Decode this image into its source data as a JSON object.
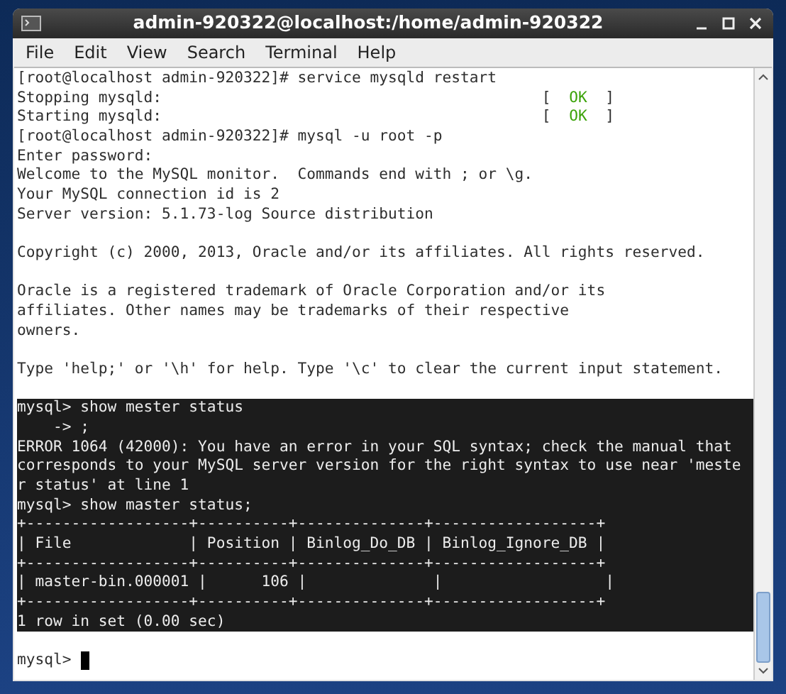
{
  "window": {
    "title": "admin-920322@localhost:/home/admin-920322"
  },
  "menu": [
    "File",
    "Edit",
    "View",
    "Search",
    "Terminal",
    "Help"
  ],
  "lines": [
    {
      "text": "[root@localhost admin-920322]# service mysqld restart",
      "selected": false
    },
    {
      "text": "Stopping mysqld:",
      "selected": false,
      "status": {
        "open": "[",
        "label": "OK",
        "close": "]"
      }
    },
    {
      "text": "Starting mysqld:",
      "selected": false,
      "status": {
        "open": "[",
        "label": "OK",
        "close": "]"
      }
    },
    {
      "text": "[root@localhost admin-920322]# mysql -u root -p",
      "selected": false
    },
    {
      "text": "Enter password:",
      "selected": false
    },
    {
      "text": "Welcome to the MySQL monitor.  Commands end with ; or \\g.",
      "selected": false
    },
    {
      "text": "Your MySQL connection id is 2",
      "selected": false
    },
    {
      "text": "Server version: 5.1.73-log Source distribution",
      "selected": false
    },
    {
      "selected": false
    },
    {
      "text": "Copyright (c) 2000, 2013, Oracle and/or its affiliates. All rights reserved.",
      "selected": false
    },
    {
      "selected": false
    },
    {
      "text": "Oracle is a registered trademark of Oracle Corporation and/or its",
      "selected": false
    },
    {
      "text": "affiliates. Other names may be trademarks of their respective",
      "selected": false
    },
    {
      "text": "owners.",
      "selected": false
    },
    {
      "selected": false
    },
    {
      "text": "Type 'help;' or '\\h' for help. Type '\\c' to clear the current input statement.",
      "selected": false
    },
    {
      "selected": false
    },
    {
      "text": "mysql> show mester status",
      "selected": true
    },
    {
      "text": "    -> ;",
      "selected": true
    },
    {
      "text": "ERROR 1064 (42000): You have an error in your SQL syntax; check the manual that",
      "selected": true
    },
    {
      "text": "corresponds to your MySQL server version for the right syntax to use near 'meste",
      "selected": true
    },
    {
      "text": "r status' at line 1",
      "selected": true
    },
    {
      "text": "mysql> show master status;",
      "selected": true
    },
    {
      "text": "+------------------+----------+--------------+------------------+",
      "selected": true
    },
    {
      "text": "| File             | Position | Binlog_Do_DB | Binlog_Ignore_DB |",
      "selected": true
    },
    {
      "text": "+------------------+----------+--------------+------------------+",
      "selected": true
    },
    {
      "text": "| master-bin.000001 |      106 |              |                  |",
      "selected": true
    },
    {
      "text": "+------------------+----------+--------------+------------------+",
      "selected": true
    },
    {
      "text": "1 row in set (0.00 sec)",
      "selected": true
    },
    {
      "selected": false
    },
    {
      "text": "mysql> ",
      "selected": false,
      "cursor": true
    }
  ]
}
